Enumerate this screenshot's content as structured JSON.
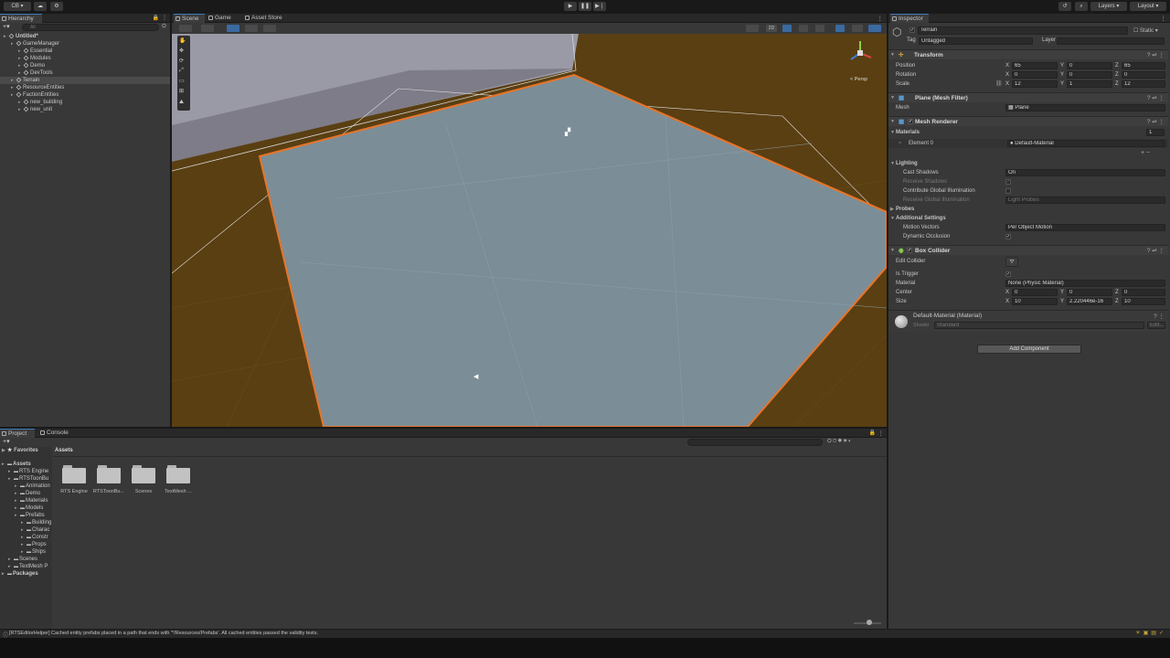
{
  "topbar": {
    "account": "CB",
    "layers": "Layers",
    "layout": "Layout"
  },
  "hierarchy": {
    "tab": "Hierarchy",
    "search_placeholder": "All",
    "items": [
      {
        "label": "Untitled*",
        "depth": 0,
        "bold": true
      },
      {
        "label": "GameManager",
        "depth": 1
      },
      {
        "label": "Essential",
        "depth": 2
      },
      {
        "label": "Modules",
        "depth": 2
      },
      {
        "label": "Demo",
        "depth": 2
      },
      {
        "label": "DevTools",
        "depth": 2
      },
      {
        "label": "Terrain",
        "depth": 1,
        "selected": true
      },
      {
        "label": "ResourceEntities",
        "depth": 1
      },
      {
        "label": "FactionEntities",
        "depth": 1
      },
      {
        "label": "new_building",
        "depth": 2
      },
      {
        "label": "new_unit",
        "depth": 2
      }
    ]
  },
  "scene": {
    "tabs": [
      "Scene",
      "Game",
      "Asset Store"
    ],
    "toggle_2d": "2D",
    "persp_label": "< Persp"
  },
  "inspector": {
    "tab": "Inspector",
    "object_name": "Terrain",
    "static_label": "Static",
    "tag_label": "Tag",
    "tag_value": "Untagged",
    "layer_label": "Layer",
    "transform": {
      "title": "Transform",
      "position_label": "Position",
      "rotation_label": "Rotation",
      "scale_label": "Scale",
      "position": [
        "65",
        "0",
        "65"
      ],
      "rotation": [
        "0",
        "0",
        "0"
      ],
      "scale": [
        "12",
        "1",
        "12"
      ]
    },
    "mesh_filter": {
      "title": "Plane (Mesh Filter)",
      "mesh_label": "Mesh",
      "mesh_value": "Plane"
    },
    "mesh_renderer": {
      "title": "Mesh Renderer",
      "materials_label": "Materials",
      "materials_count": "1",
      "element0_label": "Element 0",
      "element0_value": "Default-Material",
      "lighting_label": "Lighting",
      "cast_shadows_label": "Cast Shadows",
      "cast_shadows_value": "On",
      "receive_shadows_label": "Receive Shadows",
      "contribute_gi_label": "Contribute Global Illumination",
      "receive_gi_label": "Receive Global Illumination",
      "receive_gi_value": "Light Probes",
      "probes_label": "Probes",
      "additional_label": "Additional Settings",
      "motion_vectors_label": "Motion Vectors",
      "motion_vectors_value": "Per Object Motion",
      "dynamic_occlusion_label": "Dynamic Occlusion"
    },
    "box_collider": {
      "title": "Box Collider",
      "edit_collider_label": "Edit Collider",
      "is_trigger_label": "Is Trigger",
      "material_label": "Material",
      "material_value": "None (Physic Material)",
      "center_label": "Center",
      "size_label": "Size",
      "center": [
        "0",
        "0",
        "0"
      ],
      "size": [
        "10",
        "2.220446e-16",
        "10"
      ]
    },
    "material": {
      "title": "Default-Material (Material)",
      "shader_label": "Shader",
      "shader_value": "Standard",
      "edit_label": "Edit..."
    },
    "add_component": "Add Component"
  },
  "project": {
    "tabs": [
      "Project",
      "Console"
    ],
    "favorites_label": "Favorites",
    "assets_breadcrumb": "Assets",
    "tree": [
      {
        "label": "Assets",
        "depth": 0,
        "bold": true
      },
      {
        "label": "RTS Engine",
        "depth": 1
      },
      {
        "label": "RTSToonBu",
        "depth": 1
      },
      {
        "label": "Animation",
        "depth": 2
      },
      {
        "label": "Demo",
        "depth": 2
      },
      {
        "label": "Materials",
        "depth": 2
      },
      {
        "label": "Models",
        "depth": 2
      },
      {
        "label": "Prefabs",
        "depth": 2
      },
      {
        "label": "Building",
        "depth": 3
      },
      {
        "label": "Charac",
        "depth": 3
      },
      {
        "label": "Constr",
        "depth": 3
      },
      {
        "label": "Props",
        "depth": 3
      },
      {
        "label": "Ships",
        "depth": 3
      },
      {
        "label": "Scenes",
        "depth": 1
      },
      {
        "label": "TextMesh P",
        "depth": 1
      },
      {
        "label": "Packages",
        "depth": 0,
        "bold": true
      }
    ],
    "folders": [
      "RTS Engine",
      "RTSToonBu...",
      "Scenes",
      "TextMesh ..."
    ]
  },
  "status": {
    "message": "[RTSEditorHelper] Cached entity prefabs placed in a path that ends with '*/Resources/Prefabs'. All cached entities passed the validity tests."
  },
  "colors": {
    "accent": "#3a79bb",
    "selection_outline": "#e8742a",
    "plane": "#7b8e97",
    "ground": "#5a3f12",
    "panel_bg": "#383838"
  }
}
